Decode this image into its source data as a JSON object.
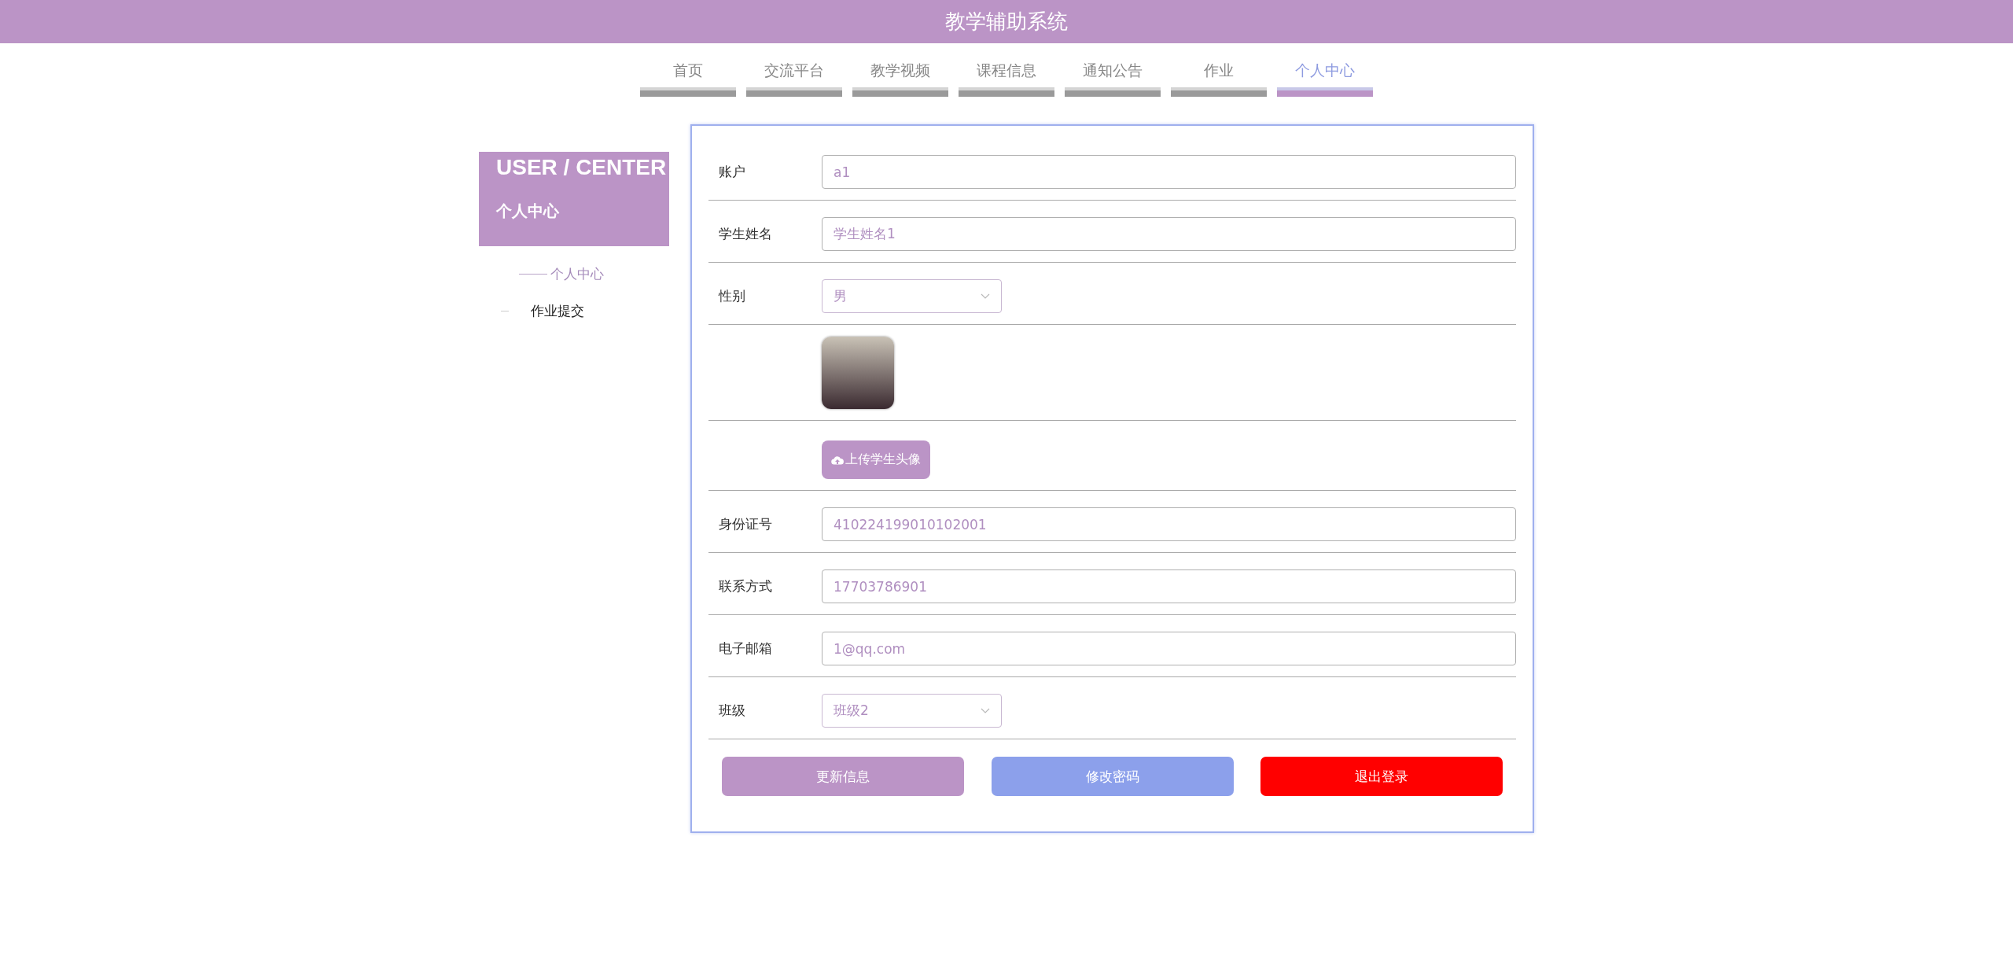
{
  "header": {
    "title": "教学辅助系统"
  },
  "nav": [
    {
      "label": "首页",
      "selected": false
    },
    {
      "label": "交流平台",
      "selected": false
    },
    {
      "label": "教学视频",
      "selected": false
    },
    {
      "label": "课程信息",
      "selected": false
    },
    {
      "label": "通知公告",
      "selected": false
    },
    {
      "label": "作业",
      "selected": false
    },
    {
      "label": "个人中心",
      "selected": true
    }
  ],
  "sidebar": {
    "title": "USER / CENTER",
    "subtitle": "个人中心",
    "items": [
      {
        "label": "个人中心",
        "selected": true
      },
      {
        "label": "作业提交",
        "selected": false
      }
    ]
  },
  "form": {
    "fields": [
      {
        "kind": "text",
        "label": "账户",
        "value": "a1"
      },
      {
        "kind": "text",
        "label": "学生姓名",
        "value": "学生姓名1"
      },
      {
        "kind": "select",
        "label": "性别",
        "value": "男"
      },
      {
        "kind": "image"
      },
      {
        "kind": "upload",
        "value": "上传学生头像"
      },
      {
        "kind": "text",
        "label": "身份证号",
        "value": "410224199010102001"
      },
      {
        "kind": "text",
        "label": "联系方式",
        "value": "17703786901"
      },
      {
        "kind": "text",
        "label": "电子邮箱",
        "value": "1@qq.com"
      },
      {
        "kind": "select",
        "label": "班级",
        "value": "班级2"
      }
    ],
    "buttons": [
      {
        "label": "更新信息",
        "color": "#bb94c6"
      },
      {
        "label": "修改密码",
        "color": "#8ca0eb"
      },
      {
        "label": "退出登录",
        "color": "#ff0000"
      }
    ]
  }
}
